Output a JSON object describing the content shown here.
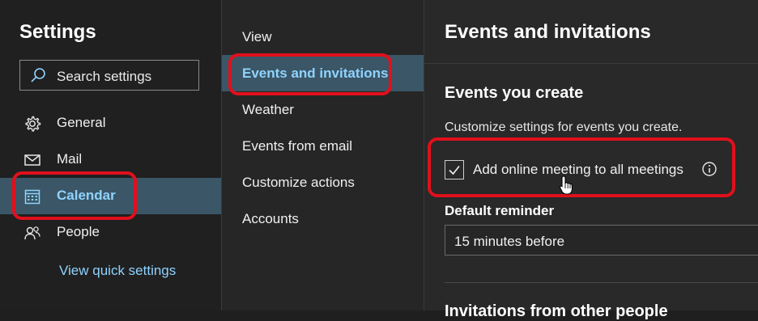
{
  "sidebar": {
    "title": "Settings",
    "search_placeholder": "Search settings",
    "items": [
      {
        "label": "General",
        "icon": "gear-icon"
      },
      {
        "label": "Mail",
        "icon": "mail-icon"
      },
      {
        "label": "Calendar",
        "icon": "calendar-icon",
        "active": true
      },
      {
        "label": "People",
        "icon": "people-icon"
      }
    ],
    "quick_settings": "View quick settings"
  },
  "subnav": {
    "items": [
      {
        "label": "View"
      },
      {
        "label": "Events and invitations",
        "active": true
      },
      {
        "label": "Weather"
      },
      {
        "label": "Events from email"
      },
      {
        "label": "Customize actions"
      },
      {
        "label": "Accounts"
      }
    ]
  },
  "main": {
    "title": "Events and invitations",
    "section_title": "Events you create",
    "section_desc": "Customize settings for events you create.",
    "online_meeting_label": "Add online meeting to all meetings",
    "online_meeting_checked": true,
    "reminder_label": "Default reminder",
    "reminder_value": "15 minutes before",
    "next_section_title": "Invitations from other people"
  },
  "colors": {
    "accent": "#8fd3ff",
    "active_bg": "#3b5666",
    "annotation": "#e0101c"
  }
}
